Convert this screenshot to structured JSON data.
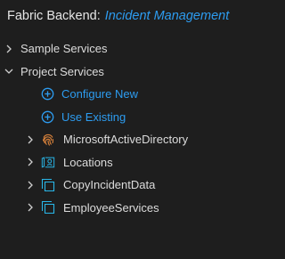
{
  "header": {
    "prefix": "Fabric Backend:",
    "project": "Incident Management"
  },
  "tree": {
    "sample_services": {
      "label": "Sample Services",
      "expanded": false
    },
    "project_services": {
      "label": "Project Services",
      "expanded": true,
      "actions": [
        {
          "label": "Configure New",
          "icon": "plus-circle-icon"
        },
        {
          "label": "Use Existing",
          "icon": "plus-circle-icon"
        }
      ],
      "services": [
        {
          "label": "MicrosoftActiveDirectory",
          "icon": "fingerprint-icon"
        },
        {
          "label": "Locations",
          "icon": "map-service-icon"
        },
        {
          "label": "CopyIncidentData",
          "icon": "integration-service-icon"
        },
        {
          "label": "EmployeeServices",
          "icon": "integration-service-icon"
        }
      ]
    }
  },
  "colors": {
    "background": "#1e1e1e",
    "text": "#dcdcdc",
    "accent_blue": "#2d9cf0",
    "fingerprint_orange": "#d9823b",
    "icon_cyan": "#29b6e8"
  }
}
